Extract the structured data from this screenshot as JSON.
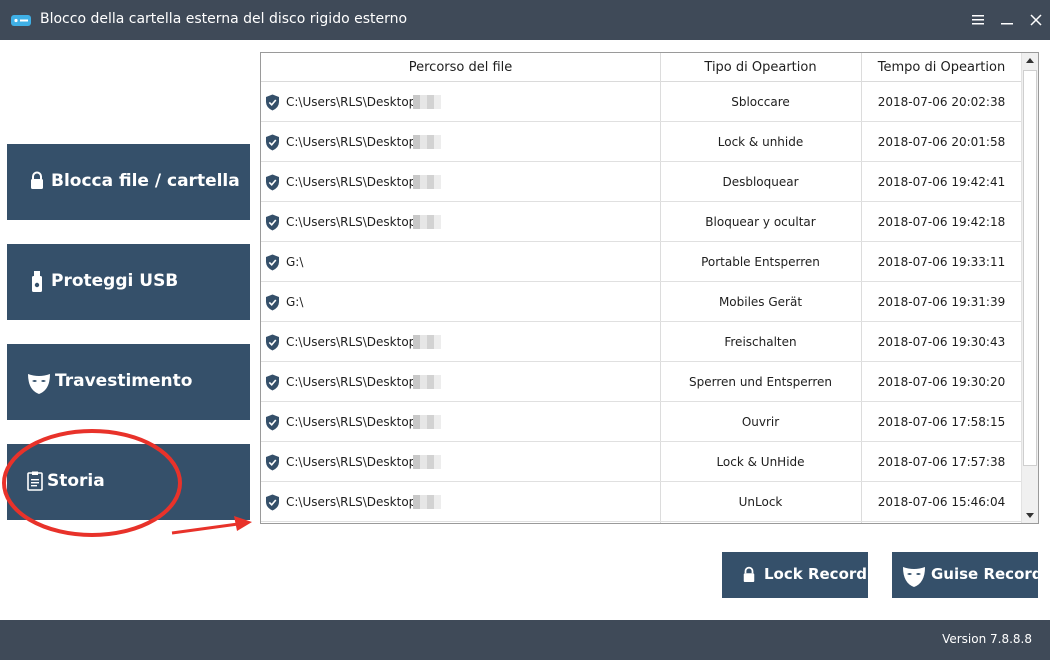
{
  "window": {
    "title": "Blocco della cartella esterna del disco rigido esterno",
    "title_bg": "#3f4a58"
  },
  "sidebar": {
    "accent": "#35506a",
    "items": [
      {
        "label": "Blocca file / cartella",
        "icon": "lock-icon"
      },
      {
        "label": "Proteggi USB",
        "icon": "usb-drive-icon"
      },
      {
        "label": "Travestimento",
        "icon": "mask-icon"
      },
      {
        "label": "Storia",
        "icon": "clipboard-icon",
        "highlighted": true
      }
    ]
  },
  "annotation": {
    "color": "#e8322a",
    "shapes": [
      "ellipse-around-storia",
      "arrow-to-table"
    ]
  },
  "table": {
    "columns": [
      "Percorso del file",
      "Tipo di Opeartion",
      "Tempo di Opeartion"
    ],
    "rows": [
      {
        "path": "C:\\Users\\RLS\\Desktop\\7",
        "op": "Sbloccare",
        "time": "2018-07-06 20:02:38",
        "blurred": true
      },
      {
        "path": "C:\\Users\\RLS\\Desktop\\7",
        "op": "Lock & unhide",
        "time": "2018-07-06 20:01:58",
        "blurred": true
      },
      {
        "path": "C:\\Users\\RLS\\Desktop\\7",
        "op": "Desbloquear",
        "time": "2018-07-06 19:42:41",
        "blurred": true
      },
      {
        "path": "C:\\Users\\RLS\\Desktop\\7",
        "op": "Bloquear y ocultar",
        "time": "2018-07-06 19:42:18",
        "blurred": true
      },
      {
        "path": "G:\\",
        "op": "Portable Entsperren",
        "time": "2018-07-06 19:33:11",
        "blurred": false
      },
      {
        "path": "G:\\",
        "op": "Mobiles Gerät",
        "time": "2018-07-06 19:31:39",
        "blurred": false
      },
      {
        "path": "C:\\Users\\RLS\\Desktop\\7",
        "op": "Freischalten",
        "time": "2018-07-06 19:30:43",
        "blurred": true
      },
      {
        "path": "C:\\Users\\RLS\\Desktop\\7",
        "op": "Sperren und Entsperren",
        "time": "2018-07-06 19:30:20",
        "blurred": true
      },
      {
        "path": "C:\\Users\\RLS\\Desktop\\7",
        "op": "Ouvrir",
        "time": "2018-07-06 17:58:15",
        "blurred": true
      },
      {
        "path": "C:\\Users\\RLS\\Desktop\\7",
        "op": "Lock & UnHide",
        "time": "2018-07-06 17:57:38",
        "blurred": true
      },
      {
        "path": "C:\\Users\\RLS\\Desktop\\7",
        "op": "UnLock",
        "time": "2018-07-06 15:46:04",
        "blurred": true
      }
    ]
  },
  "actions": {
    "lock_record": "Lock Record",
    "guise_record": "Guise Record"
  },
  "footer": {
    "version": "Version 7.8.8.8"
  }
}
